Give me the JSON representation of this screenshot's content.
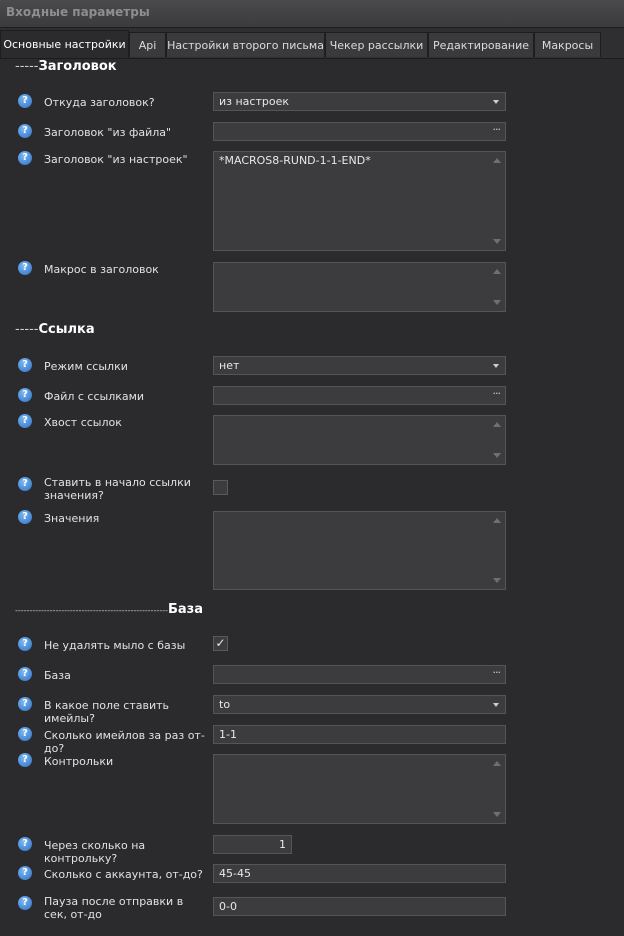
{
  "window": {
    "title": "Входные параметры"
  },
  "tabs": [
    {
      "label": "Основные настройки",
      "active": true
    },
    {
      "label": "Api"
    },
    {
      "label": "Настройки второго письма"
    },
    {
      "label": "Чекер рассылки"
    },
    {
      "label": "Редактирование"
    },
    {
      "label": "Макросы"
    }
  ],
  "help_glyph": "?",
  "sections": {
    "header": {
      "dashes": "-----",
      "title": "Заголовок"
    },
    "link": {
      "dashes": "-----",
      "title": "Ссылка"
    },
    "base": {
      "dashes": "-----------------------------------------------------",
      "title": "База"
    }
  },
  "header": {
    "source_label": "Откуда заголовок?",
    "source_value": "из настроек",
    "file_label": "Заголовок \"из файла\"",
    "file_value": "",
    "settings_label": "Заголовок \"из настроек\"",
    "settings_value": "*MACROS8-RUND-1-1-END*",
    "macro_label": "Макрос в заголовок",
    "macro_value": ""
  },
  "link": {
    "mode_label": "Режим ссылки",
    "mode_value": "нет",
    "file_label": "Файл с ссылками",
    "file_value": "",
    "tail_label": "Хвост ссылок",
    "tail_value": "",
    "prefix_label": "Ставить в начало ссылки значения?",
    "prefix_checked": false,
    "values_label": "Значения",
    "values_value": ""
  },
  "base": {
    "keep_label": "Не удалять мыло с базы",
    "keep_checked": true,
    "keep_mark": "✓",
    "base_label": "База",
    "base_value": "",
    "field_label": "В какое поле ставить имейлы?",
    "field_value": "to",
    "count_label": "Сколько имейлов за раз от-до?",
    "count_value": "1-1",
    "controls_label": "Контрольки",
    "controls_value": "",
    "every_label": "Через сколько на контрольку?",
    "every_value": "1",
    "per_account_label": "Сколько с аккаунта, от-до?",
    "per_account_value": "45-45",
    "pause_label": "Пауза после отправки в сек, от-до",
    "pause_value": "0-0"
  },
  "ellipsis": "···"
}
